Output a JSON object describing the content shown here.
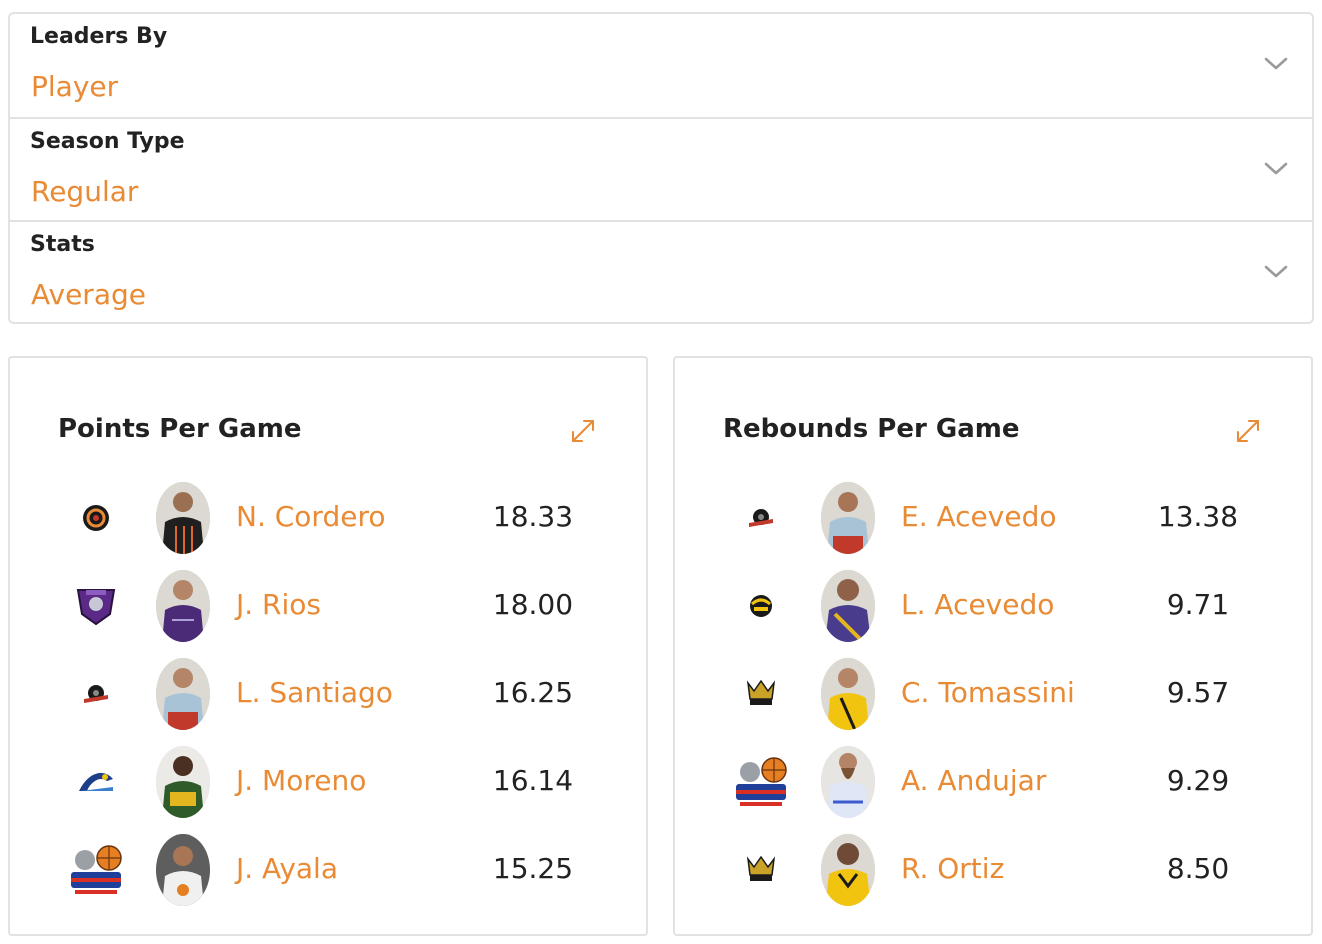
{
  "filters": [
    {
      "label": "Leaders By",
      "value": "Player",
      "icon": "chevron-down-icon"
    },
    {
      "label": "Season Type",
      "value": "Regular",
      "icon": "chevron-down-icon"
    },
    {
      "label": "Stats",
      "value": "Average",
      "icon": "chevron-down-icon"
    }
  ],
  "colors": {
    "accent": "#e98a35",
    "text": "#222222",
    "border": "#e2e2e2"
  },
  "cards": [
    {
      "title": "Points Per Game",
      "expand_icon": "expand-icon",
      "rows": [
        {
          "name": "N. Cordero",
          "value": "18.33",
          "team_icon": "team-logo-black-orange-crest",
          "avatar_icon": "player-photo"
        },
        {
          "name": "J. Rios",
          "value": "18.00",
          "team_icon": "team-logo-knights-purple",
          "avatar_icon": "player-photo"
        },
        {
          "name": "L. Santiago",
          "value": "16.25",
          "team_icon": "team-logo-red-black-crest",
          "avatar_icon": "player-photo"
        },
        {
          "name": "J. Moreno",
          "value": "16.14",
          "team_icon": "team-logo-blue-yellow-wave",
          "avatar_icon": "player-photo"
        },
        {
          "name": "J. Ayala",
          "value": "15.25",
          "team_icon": "team-logo-leneros",
          "avatar_icon": "player-photo"
        }
      ]
    },
    {
      "title": "Rebounds Per Game",
      "expand_icon": "expand-icon",
      "rows": [
        {
          "name": "E. Acevedo",
          "value": "13.38",
          "team_icon": "team-logo-red-black-crest",
          "avatar_icon": "player-photo"
        },
        {
          "name": "L. Acevedo",
          "value": "9.71",
          "team_icon": "team-logo-gold-black-crest",
          "avatar_icon": "player-photo"
        },
        {
          "name": "C. Tomassini",
          "value": "9.57",
          "team_icon": "team-logo-titanes-crown",
          "avatar_icon": "player-photo"
        },
        {
          "name": "A. Andujar",
          "value": "9.29",
          "team_icon": "team-logo-leneros",
          "avatar_icon": "player-photo"
        },
        {
          "name": "R. Ortiz",
          "value": "8.50",
          "team_icon": "team-logo-titanes-crown",
          "avatar_icon": "player-photo"
        }
      ]
    }
  ]
}
